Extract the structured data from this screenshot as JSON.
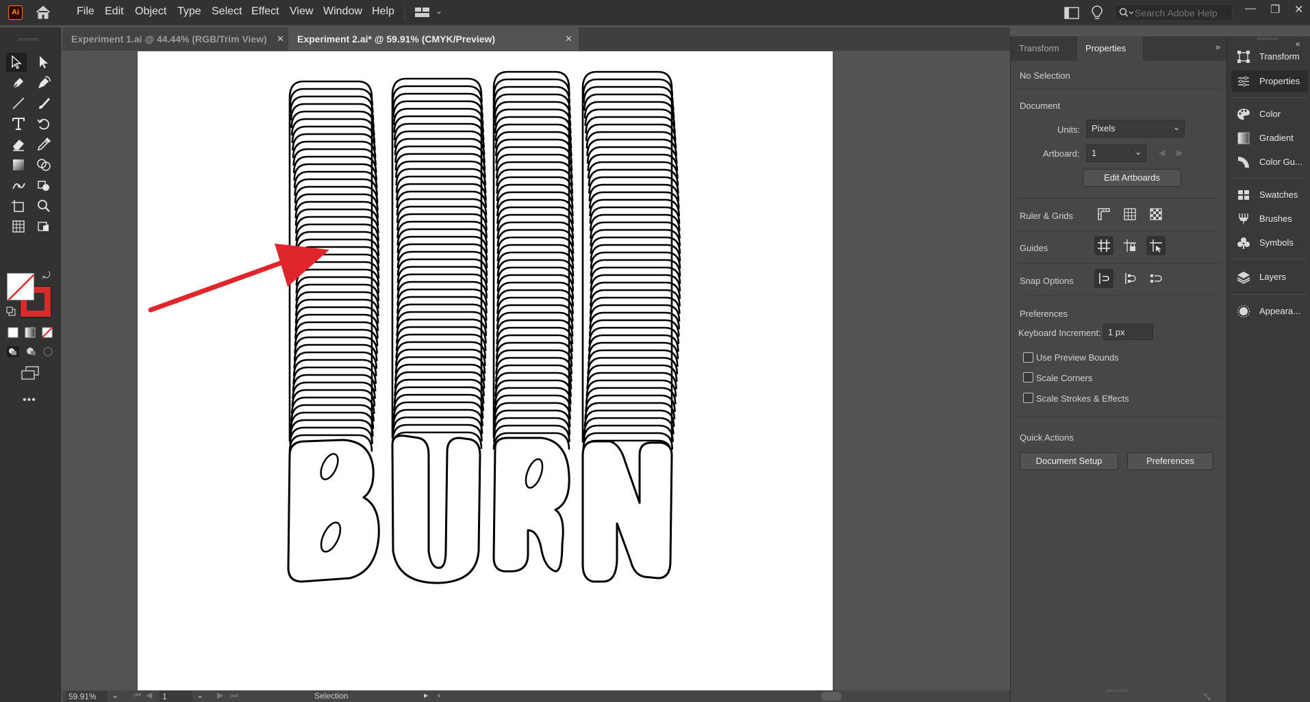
{
  "app": {
    "logo": "Ai",
    "menu": [
      "File",
      "Edit",
      "Object",
      "Type",
      "Select",
      "Effect",
      "View",
      "Window",
      "Help"
    ],
    "search_placeholder": "Search Adobe Help",
    "accent_color": "#ff9a00"
  },
  "tabs": [
    {
      "label": "Experiment 1.ai @ 44.44% (RGB/Trim View)",
      "active": false
    },
    {
      "label": "Experiment 2.ai* @ 59.91% (CMYK/Preview)",
      "active": true
    }
  ],
  "toolbar": {
    "tools": [
      "selection-tool",
      "direct-selection-tool",
      "pen-tool",
      "curvature-tool",
      "line-tool",
      "paintbrush-tool",
      "type-tool",
      "rotate-tool",
      "eraser-tool",
      "eyedropper-tool",
      "gradient-tool",
      "shape-builder-tool",
      "puppet-warp-tool",
      "live-paint-tool",
      "artboard-tool",
      "zoom-tool",
      "graph-tool",
      "symbol-sprayer-tool"
    ],
    "fill_color": "none",
    "stroke_color": "#d82c2c",
    "more_label": "•••"
  },
  "canvas": {
    "artwork_text": "BURN",
    "annotation": "red-arrow",
    "annotation_color": "#e0262a"
  },
  "status": {
    "zoom": "59.91%",
    "artboard_number": "1",
    "tool_name": "Selection"
  },
  "properties": {
    "tabs": [
      "Transform",
      "Properties"
    ],
    "selection": "No Selection",
    "document": {
      "title": "Document",
      "units_label": "Units:",
      "units_value": "Pixels",
      "artboard_label": "Artboard:",
      "artboard_value": "1",
      "edit_artboards": "Edit Artboards"
    },
    "ruler_grids": "Ruler & Grids",
    "guides": "Guides",
    "snap_options": "Snap Options",
    "preferences": {
      "title": "Preferences",
      "keyboard_increment_label": "Keyboard Increment:",
      "keyboard_increment_value": "1 px",
      "use_preview_bounds": "Use Preview Bounds",
      "scale_corners": "Scale Corners",
      "scale_strokes": "Scale Strokes & Effects"
    },
    "quick_actions": {
      "title": "Quick Actions",
      "document_setup": "Document Setup",
      "preferences": "Preferences"
    }
  },
  "dock": [
    {
      "label": "Transform",
      "icon": "transform-icon"
    },
    {
      "label": "Properties",
      "icon": "properties-icon",
      "active": true
    },
    {
      "label": "Color",
      "icon": "color-icon"
    },
    {
      "label": "Gradient",
      "icon": "gradient-icon"
    },
    {
      "label": "Color Gu...",
      "icon": "color-guide-icon"
    },
    {
      "label": "Swatches",
      "icon": "swatches-icon"
    },
    {
      "label": "Brushes",
      "icon": "brushes-icon"
    },
    {
      "label": "Symbols",
      "icon": "symbols-icon"
    },
    {
      "label": "Layers",
      "icon": "layers-icon"
    },
    {
      "label": "Appeara...",
      "icon": "appearance-icon"
    }
  ]
}
